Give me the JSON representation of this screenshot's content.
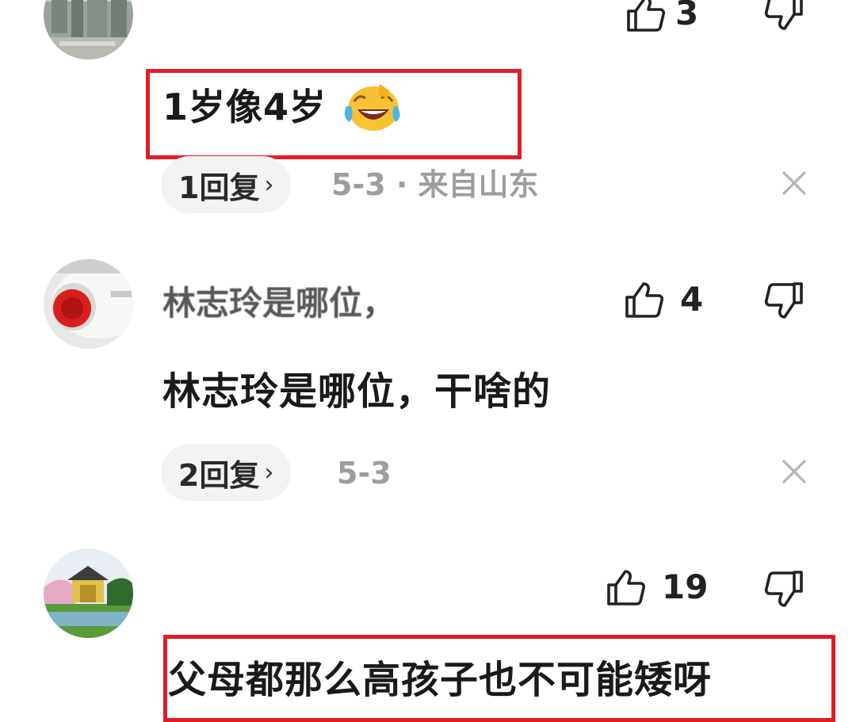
{
  "comments": [
    {
      "username": "",
      "text": "1岁像4岁",
      "emoji": "laughing-crying-emoji",
      "likes": "3",
      "reply_label": "1回复",
      "meta": "5-3 · 来自山东",
      "highlighted": true
    },
    {
      "username": "林志玲是哪位，",
      "text": "林志玲是哪位，干啥的",
      "likes": "4",
      "reply_label": "2回复",
      "meta": "5-3",
      "highlighted": false
    },
    {
      "username": "",
      "text": "父母都那么高孩子也不可能矮呀",
      "likes": "19",
      "highlighted": true
    }
  ],
  "icons": {
    "like": "thumbs-up-icon",
    "dislike": "thumbs-down-icon",
    "close": "close-icon",
    "chevron": "chevron-right-icon"
  },
  "colors": {
    "highlight": "#e01d23",
    "pill_bg": "#f3f3f3",
    "meta_text": "#9d9d9d"
  }
}
